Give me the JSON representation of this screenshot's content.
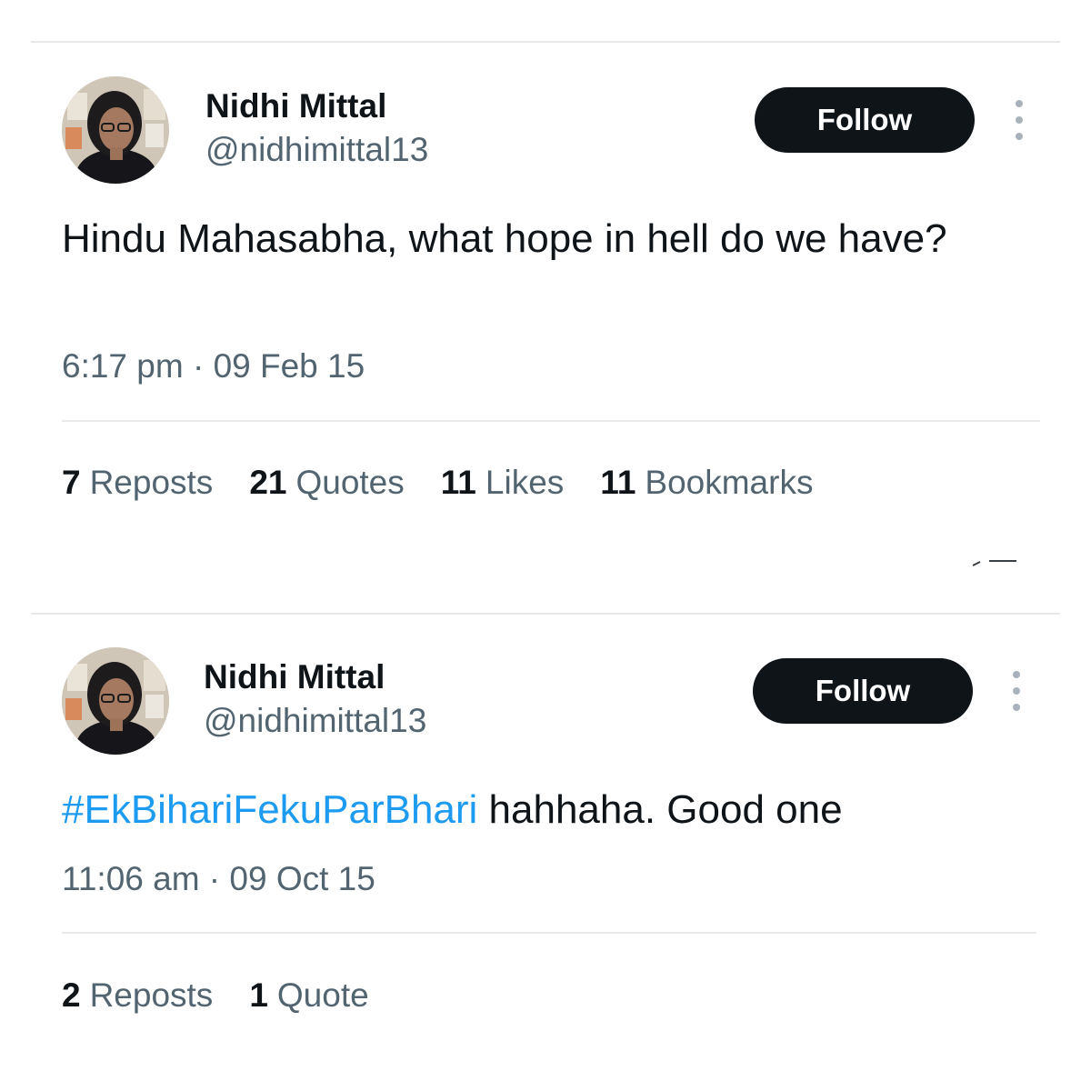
{
  "tweets": [
    {
      "author": {
        "name": "Nidhi Mittal",
        "handle": "@nidhimittal13"
      },
      "follow_label": "Follow",
      "text_parts": [
        {
          "type": "text",
          "value": "Hindu Mahasabha, what hope in hell do we have?"
        }
      ],
      "timestamp": "6:17 pm · 09 Feb 15",
      "stats": [
        {
          "count": "7",
          "label": "Reposts"
        },
        {
          "count": "21",
          "label": "Quotes"
        },
        {
          "count": "11",
          "label": "Likes"
        },
        {
          "count": "11",
          "label": "Bookmarks"
        }
      ]
    },
    {
      "author": {
        "name": "Nidhi Mittal",
        "handle": "@nidhimittal13"
      },
      "follow_label": "Follow",
      "text_parts": [
        {
          "type": "hashtag",
          "value": "#EkBihariFekuParBhari"
        },
        {
          "type": "text",
          "value": " hahhaha. Good one"
        }
      ],
      "timestamp": "11:06 am · 09 Oct 15",
      "stats": [
        {
          "count": "2",
          "label": "Reposts"
        },
        {
          "count": "1",
          "label": "Quote"
        }
      ]
    }
  ],
  "colors": {
    "text_primary": "#0f1419",
    "text_secondary": "#536471",
    "hashtag": "#1d9bf0",
    "button_bg": "#0f1419",
    "divider": "#e6e8ea"
  },
  "icons": {
    "more": "more-vertical-icon",
    "avatar": "avatar"
  }
}
